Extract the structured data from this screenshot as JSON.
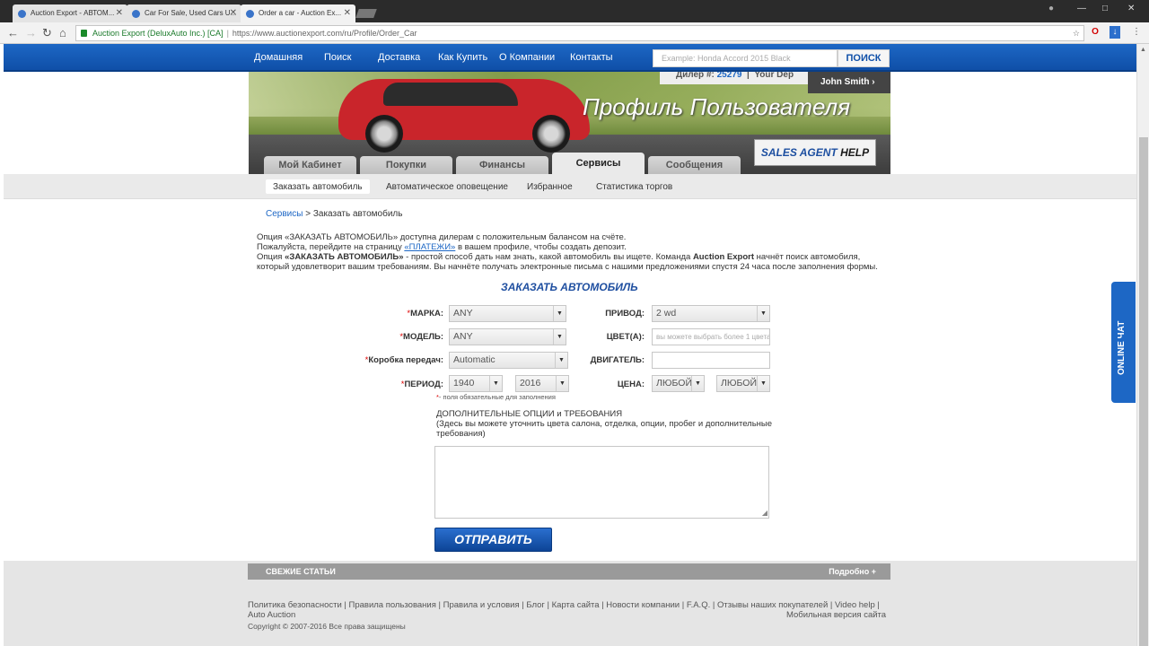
{
  "browser": {
    "tabs": [
      {
        "title": "Auction Export - АВТОМ..."
      },
      {
        "title": "Car For Sale, Used Cars U..."
      },
      {
        "title": "Order a car - Auction Ex..."
      }
    ],
    "site_identity": "Auction Export (DeluxAuto Inc.) [CA]",
    "url": "https://www.auctionexport.com/ru/Profile/Order_Car"
  },
  "nav": {
    "items": [
      "Домашняя",
      "Поиск",
      "Доставка",
      "Как Купить",
      "О Компании",
      "Контакты"
    ],
    "search_placeholder": "Example: Honda Accord 2015 Black",
    "search_button": "ПОИСК"
  },
  "banner": {
    "dealer_label": "Дилер #:",
    "dealer_number": "25279",
    "deposit_label": "Your Dep",
    "user_name": "John Smith",
    "title": "Профиль Пользователя",
    "help_button": {
      "blue": "SALES AGENT",
      "black": "HELP"
    },
    "tabs": [
      "Мой Кабинет",
      "Покупки",
      "Финансы",
      "Сервисы",
      "Сообщения"
    ],
    "active_tab": "Сервисы"
  },
  "subnav": [
    "Заказать автомобиль",
    "Автоматическое оповещение",
    "Избранное",
    "Статистика торгов"
  ],
  "breadcrumb": {
    "parent": "Сервисы",
    "separator": ">",
    "current": "Заказать автомобиль"
  },
  "intro": {
    "line1": "Опция «ЗАКАЗАТЬ АВТОМОБИЛЬ» доступна дилерам с положительным балансом на счёте.",
    "line2_before": "Пожалуйста, перейдите на страницу ",
    "line2_link": "«ПЛАТЕЖИ»",
    "line2_after": " в вашем профиле, чтобы создать депозит.",
    "line3_start": "Опция ",
    "line3_bold": "«ЗАКАЗАТЬ АВТОМОБИЛЬ»",
    "line3_mid": " - простой способ дать нам знать, какой автомобиль вы ищете. Команда ",
    "line3_brand": "Auction Export",
    "line3_end": " начнёт поиск автомобиля, который удовлетворит вашим требованиям. Вы начнёте получать электронные письма с нашими предложениями спустя 24 часа после заполнения формы."
  },
  "form": {
    "title": "ЗАКАЗАТЬ АВТОМОБИЛЬ",
    "make_label": "МАРКА:",
    "make_value": "ANY",
    "model_label": "МОДЕЛЬ:",
    "model_value": "ANY",
    "transmission_label": "Коробка передач:",
    "transmission_value": "Automatic",
    "period_label": "ПЕРИОД:",
    "period_from": "1940",
    "period_to": "2016",
    "drive_label": "ПРИВОД:",
    "drive_value": "2 wd",
    "color_label": "ЦВЕТ(А):",
    "color_placeholder": "вы можете выбрать более 1 цвета",
    "engine_label": "ДВИГАТЕЛЬ:",
    "price_label": "ЦЕНА:",
    "price_from": "ЛЮБОЙ",
    "price_to": "ЛЮБОЙ",
    "required_note": "- поля обязательные для заполнения",
    "options_title": "ДОПОЛНИТЕЛЬНЫЕ ОПЦИИ и ТРЕБОВАНИЯ",
    "options_hint": "(Здесь вы можете уточнить цвета салона, отделка, опции, пробег и дополнительные требования)",
    "submit": "ОТПРАВИТЬ"
  },
  "footer": {
    "articles_title": "СВЕЖИЕ СТАТЬИ",
    "articles_more": "Подробно +",
    "links": "Политика безопасности | Правила пользования | Правила и условия | Блог | Карта сайта | Новости компании | F.A.Q. | Отзывы наших покупателей | Video help | Auto Auction",
    "mobile": "Мобильная версия сайта",
    "copyright": "Copyright © 2007-2016 Все права защищены"
  },
  "chat": "ONLINE ЧАТ"
}
